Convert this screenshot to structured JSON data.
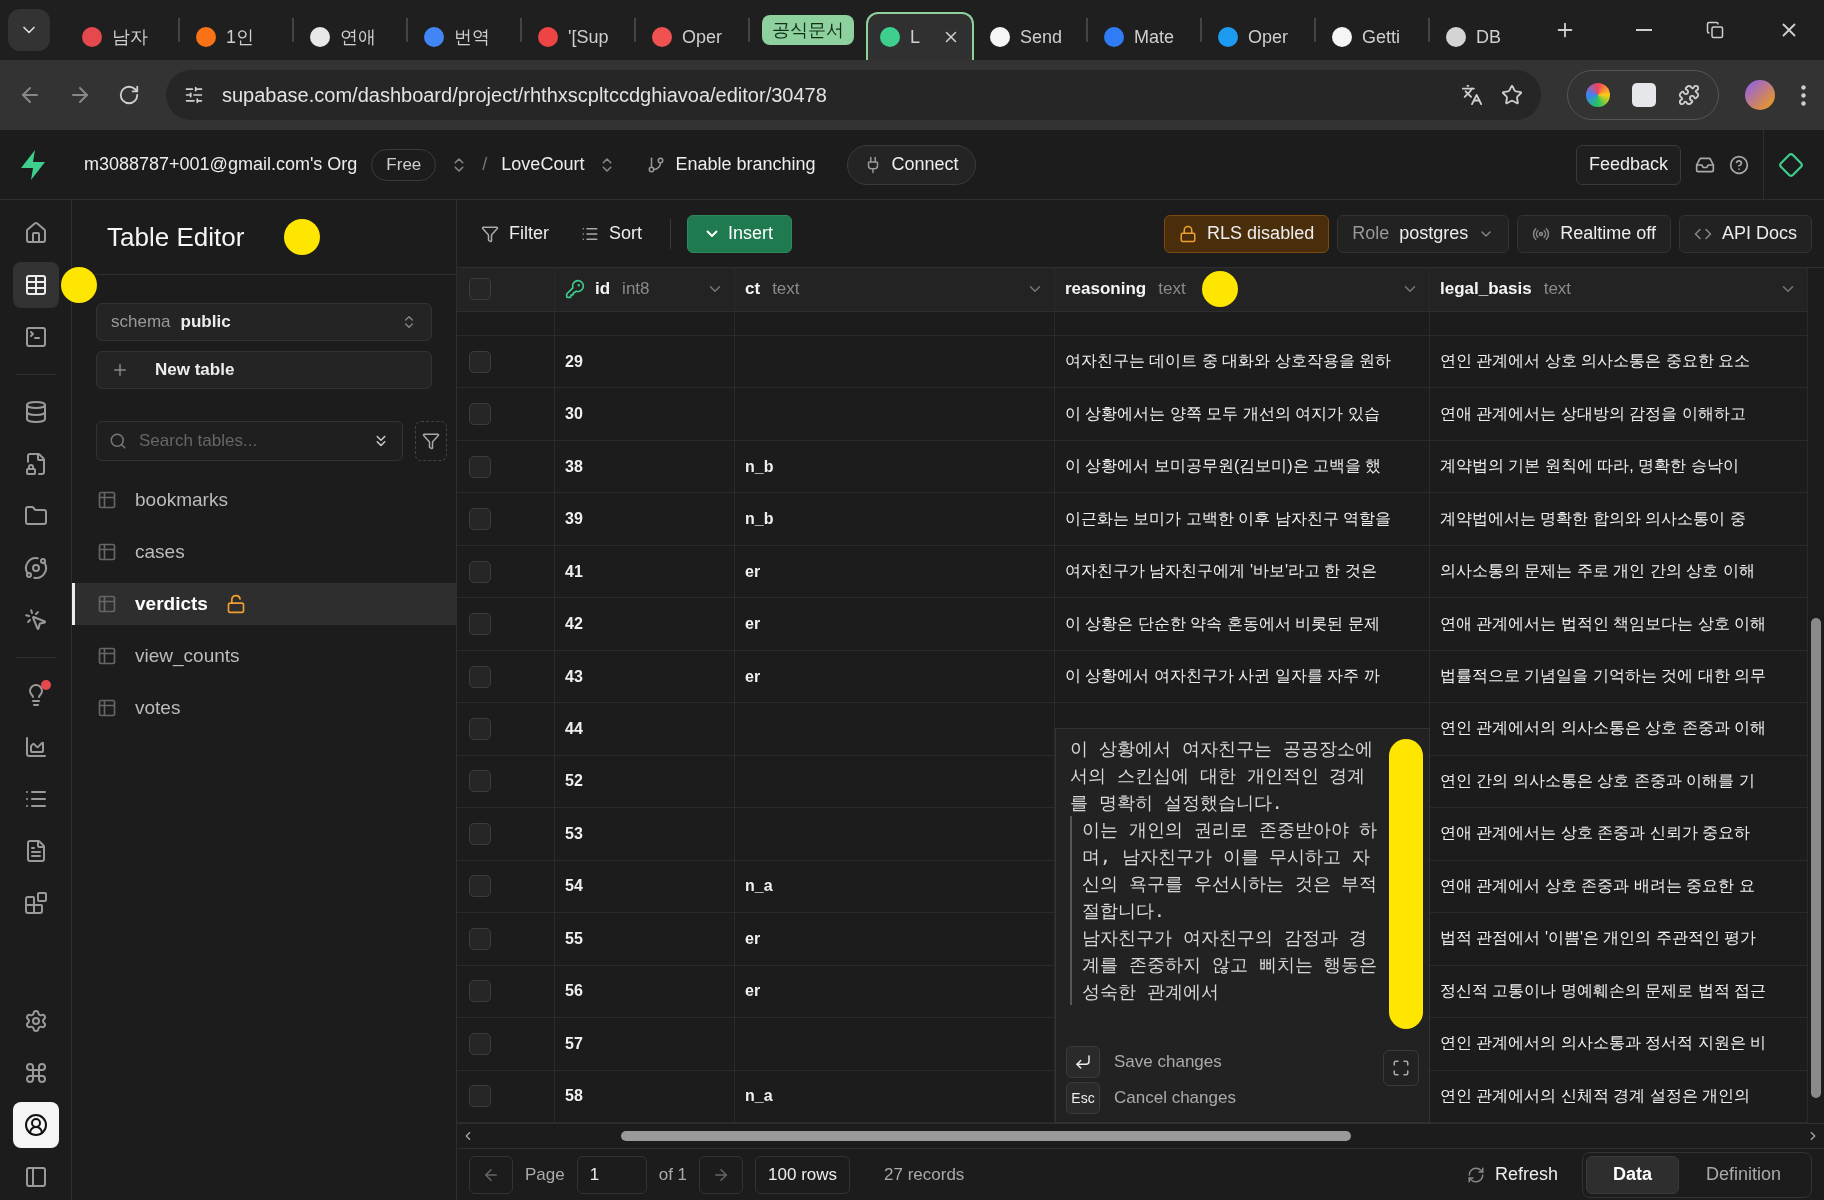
{
  "browser": {
    "tabs": [
      {
        "kind": "tab",
        "title": "남자",
        "color": "#e5484d",
        "selected": false
      },
      {
        "kind": "tab",
        "title": "1인",
        "color": "#f97316",
        "selected": false
      },
      {
        "kind": "tab",
        "title": "연애",
        "color": "#e8e8e8",
        "selected": false
      },
      {
        "kind": "tab",
        "title": "번역",
        "color": "#4285f4",
        "selected": false
      },
      {
        "kind": "tab",
        "title": "'[Sup",
        "color": "#ef4444",
        "selected": false
      },
      {
        "kind": "tab",
        "title": "Oper",
        "color": "#f05252",
        "selected": false
      },
      {
        "kind": "group",
        "title": "공식문서",
        "color": "#8fd19e"
      },
      {
        "kind": "tab",
        "title": "L",
        "color": "#3ecf8e",
        "selected": true
      },
      {
        "kind": "tab",
        "title": "Send",
        "color": "#f5f5f5",
        "selected": false
      },
      {
        "kind": "tab",
        "title": "Mate",
        "color": "#2f7cf6",
        "selected": false
      },
      {
        "kind": "tab",
        "title": "Oper",
        "color": "#1d9bf0",
        "selected": false
      },
      {
        "kind": "tab",
        "title": "Getti",
        "color": "#f5f5f5",
        "selected": false
      },
      {
        "kind": "tab",
        "title": "DB",
        "color": "#d4d4d4",
        "selected": false
      }
    ],
    "url": "supabase.com/dashboard/project/rhthxscpltccdghiavoa/editor/30478"
  },
  "header": {
    "org": "m3088787+001@gmail.com's Org",
    "plan": "Free",
    "separator": "/",
    "project": "LoveCourt",
    "branching": "Enable branching",
    "connect": "Connect",
    "feedback": "Feedback"
  },
  "rail": [
    {
      "kind": "home",
      "selected": false,
      "badge": false
    },
    {
      "kind": "table",
      "selected": true,
      "badge": false,
      "highlight": true
    },
    {
      "kind": "terminal",
      "selected": false,
      "badge": false
    },
    {
      "kind": "database",
      "selected": false,
      "badge": false
    },
    {
      "kind": "auth",
      "selected": false,
      "badge": false
    },
    {
      "kind": "storage",
      "selected": false,
      "badge": false
    },
    {
      "kind": "realtime",
      "selected": false,
      "badge": false
    },
    {
      "kind": "functions",
      "selected": false,
      "badge": false
    },
    {
      "kind": "advisors",
      "selected": false,
      "badge": true
    },
    {
      "kind": "reports",
      "selected": false,
      "badge": false
    },
    {
      "kind": "logs",
      "selected": false,
      "badge": false
    },
    {
      "kind": "docs",
      "selected": false,
      "badge": false
    },
    {
      "kind": "integrations",
      "selected": false,
      "badge": false
    },
    {
      "kind": "settings",
      "selected": false,
      "badge": false
    },
    {
      "kind": "command",
      "selected": false,
      "badge": false
    },
    {
      "kind": "account",
      "selected": false,
      "badge": false
    },
    {
      "kind": "collapse",
      "selected": false,
      "badge": false
    }
  ],
  "sidebar": {
    "title": "Table Editor",
    "highlight": true,
    "schema_label": "schema",
    "schema": "public",
    "new_table": "New table",
    "search": {
      "placeholder": "Search tables..."
    },
    "tables": [
      {
        "name": "bookmarks",
        "selected": false,
        "rls_disabled": false
      },
      {
        "name": "cases",
        "selected": false,
        "rls_disabled": false
      },
      {
        "name": "verdicts",
        "selected": true,
        "rls_disabled": true
      },
      {
        "name": "view_counts",
        "selected": false,
        "rls_disabled": false
      },
      {
        "name": "votes",
        "selected": false,
        "rls_disabled": false
      }
    ]
  },
  "toolbar": {
    "filter": "Filter",
    "sort": "Sort",
    "insert": "Insert",
    "rls": "RLS disabled",
    "role_label": "Role",
    "role": "postgres",
    "realtime": "Realtime off",
    "api_docs": "API Docs"
  },
  "table": {
    "all_checked": false,
    "columns": [
      {
        "name": "id",
        "type": "int8",
        "primary_key": true
      },
      {
        "name": "ct",
        "type": "text",
        "primary_key": false
      },
      {
        "name": "reasoning",
        "type": "text",
        "primary_key": false,
        "highlight": true
      },
      {
        "name": "legal_basis",
        "type": "text",
        "primary_key": false
      }
    ],
    "rows": [
      {
        "checked": false,
        "cells": [
          "29",
          "",
          "여자친구는 데이트 중 대화와 상호작용을 원하",
          "연인 관계에서 상호 의사소통은 중요한 요소"
        ]
      },
      {
        "checked": false,
        "cells": [
          "30",
          "",
          "이 상황에서는 양쪽 모두 개선의 여지가 있습",
          "연애 관계에서는 상대방의 감정을 이해하고"
        ]
      },
      {
        "checked": false,
        "cells": [
          "38",
          "n_b",
          "이 상황에서 보미공무원(김보미)은 고백을 했",
          "계약법의 기본 원칙에 따라, 명확한 승낙이"
        ]
      },
      {
        "checked": false,
        "cells": [
          "39",
          "n_b",
          "이근화는 보미가 고백한 이후 남자친구 역할을",
          "계약법에서는 명확한 합의와 의사소통이 중"
        ]
      },
      {
        "checked": false,
        "cells": [
          "41",
          "er",
          "여자친구가 남자친구에게 '바보'라고 한 것은",
          "의사소통의 문제는 주로 개인 간의 상호 이해"
        ]
      },
      {
        "checked": false,
        "cells": [
          "42",
          "er",
          "이 상황은 단순한 약속 혼동에서 비롯된 문제",
          "연애 관계에서는 법적인 책임보다는 상호 이해"
        ]
      },
      {
        "checked": false,
        "cells": [
          "43",
          "er",
          "이 상황에서 여자친구가 사귄 일자를 자주 까",
          "법률적으로 기념일을 기억하는 것에 대한 의무"
        ]
      },
      {
        "checked": false,
        "cells": [
          "44",
          "",
          "",
          "연인 관계에서의 의사소통은 상호 존중과 이해"
        ]
      },
      {
        "checked": false,
        "cells": [
          "52",
          "",
          "",
          "연인 간의 의사소통은 상호 존중과 이해를 기"
        ]
      },
      {
        "checked": false,
        "cells": [
          "53",
          "",
          "",
          "연애 관계에서는 상호 존중과 신뢰가 중요하"
        ]
      },
      {
        "checked": false,
        "cells": [
          "54",
          "n_a",
          "",
          "연애 관계에서 상호 존중과 배려는 중요한 요"
        ]
      },
      {
        "checked": false,
        "cells": [
          "55",
          "er",
          "",
          "법적 관점에서 '이쁨'은 개인의 주관적인 평가"
        ]
      },
      {
        "checked": false,
        "cells": [
          "56",
          "er",
          "",
          "정신적 고통이나 명예훼손의 문제로 법적 접근"
        ]
      },
      {
        "checked": false,
        "cells": [
          "57",
          "",
          "",
          "연인 관계에서의 의사소통과 정서적 지원은 비"
        ]
      },
      {
        "checked": false,
        "cells": [
          "58",
          "n_a",
          "",
          "연인 관계에서의 신체적 경계 설정은 개인의"
        ]
      }
    ]
  },
  "editor": {
    "highlight": true,
    "paragraphs": [
      {
        "text": "이 상황에서 여자친구는 공공장소에서의 스킨십에 대한 개인적인 경계를 명확히 설정했습니다.",
        "quoted": false
      },
      {
        "text": "이는 개인의 권리로 존중받아야 하며, 남자친구가 이를 무시하고 자신의 욕구를 우선시하는 것은 부적절합니다.",
        "quoted": true
      },
      {
        "text": "남자친구가 여자친구의 감정과 경계를 존중하지 않고 삐치는 행동은 성숙한 관계에서",
        "quoted": true
      }
    ],
    "save": "Save changes",
    "esc_key": "Esc",
    "cancel": "Cancel changes"
  },
  "footer": {
    "page_label": "Page",
    "page": "1",
    "of": "of 1",
    "rows": "100 rows",
    "records": "27 records",
    "refresh": "Refresh",
    "views": [
      {
        "label": "Data",
        "selected": true
      },
      {
        "label": "Definition",
        "selected": false
      }
    ]
  }
}
